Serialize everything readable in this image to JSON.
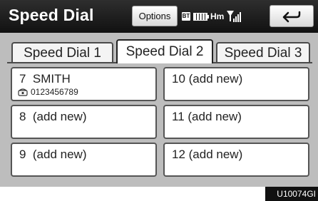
{
  "header": {
    "title": "Speed Dial",
    "options_label": "Options",
    "status": {
      "bt_label": "BT",
      "network_label": "Hm"
    }
  },
  "tabs": [
    {
      "label": "Speed Dial 1",
      "selected": false
    },
    {
      "label": "Speed Dial 2",
      "selected": true
    },
    {
      "label": "Speed Dial 3",
      "selected": false
    }
  ],
  "slots": [
    {
      "label": "7  SMITH",
      "number": "0123456789"
    },
    {
      "label": "10 (add new)"
    },
    {
      "label": "8  (add new)"
    },
    {
      "label": "11 (add new)"
    },
    {
      "label": "9  (add new)"
    },
    {
      "label": "12 (add new)"
    }
  ],
  "figure_code": "U10074GI",
  "icons": {
    "back": "back-arrow-icon",
    "phone": "phone-icon",
    "signal": "signal-antenna-icon",
    "battery": "battery-icon",
    "bluetooth": "bluetooth-icon"
  }
}
